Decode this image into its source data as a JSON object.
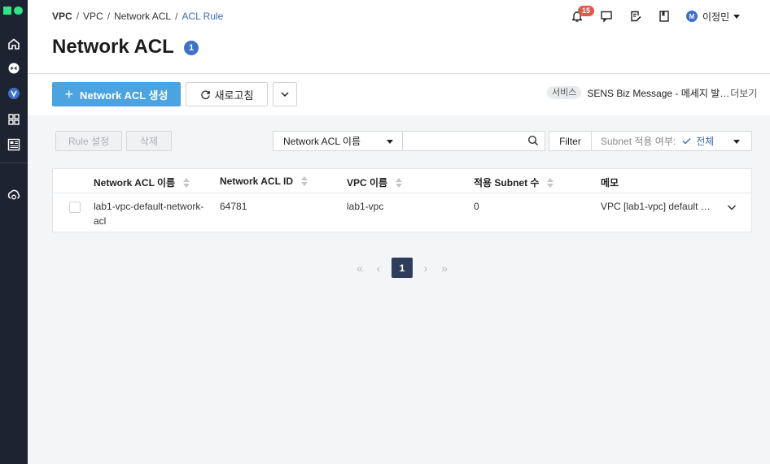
{
  "breadcrumb": {
    "items": [
      "VPC",
      "VPC",
      "Network ACL",
      "ACL Rule"
    ],
    "separator": "/"
  },
  "header": {
    "notification_count": "15",
    "user_initial": "M",
    "user_name": "이정민"
  },
  "page": {
    "title": "Network ACL",
    "count": "1"
  },
  "toolbar": {
    "create_label": "Network ACL 생성",
    "create_plus": "+",
    "refresh_label": "새로고침"
  },
  "service_notice": {
    "tag": "서비스",
    "text": "SENS Biz Message - 메세지 발…",
    "more": "더보기"
  },
  "actions": {
    "rule_setting": "Rule 설정",
    "delete": "삭제"
  },
  "search": {
    "field_selected": "Network ACL 이름",
    "value": "",
    "filter_label": "Filter",
    "subnet_label": "Subnet 적용 여부:",
    "subnet_value": "전체"
  },
  "table": {
    "columns": [
      "Network ACL 이름",
      "Network ACL ID",
      "VPC 이름",
      "적용 Subnet 수",
      "메모"
    ],
    "rows": [
      {
        "name_line1": "lab1-vpc-default-network-",
        "name_line2": "acl",
        "id": "64781",
        "vpc": "lab1-vpc",
        "subnet_count": "0",
        "memo": "VPC [lab1-vpc] default …"
      }
    ]
  },
  "pagination": {
    "current": "1",
    "first": "«",
    "prev": "‹",
    "next": "›",
    "last": "»"
  },
  "colors": {
    "sidebar_bg": "#1d2330",
    "logo_green": "#2ee58a",
    "primary_button": "#4ba3e0",
    "badge_red": "#e2574c",
    "link_blue": "#3d6cb1",
    "pager_active": "#2f3d5c"
  },
  "icons": {
    "sidebar": [
      "home-icon",
      "globe-icon",
      "v-badge-icon",
      "grid-icon",
      "catalog-icon",
      "cloud-sync-icon"
    ],
    "header": [
      "bell-icon",
      "chat-icon",
      "edit-doc-icon",
      "book-icon"
    ]
  }
}
